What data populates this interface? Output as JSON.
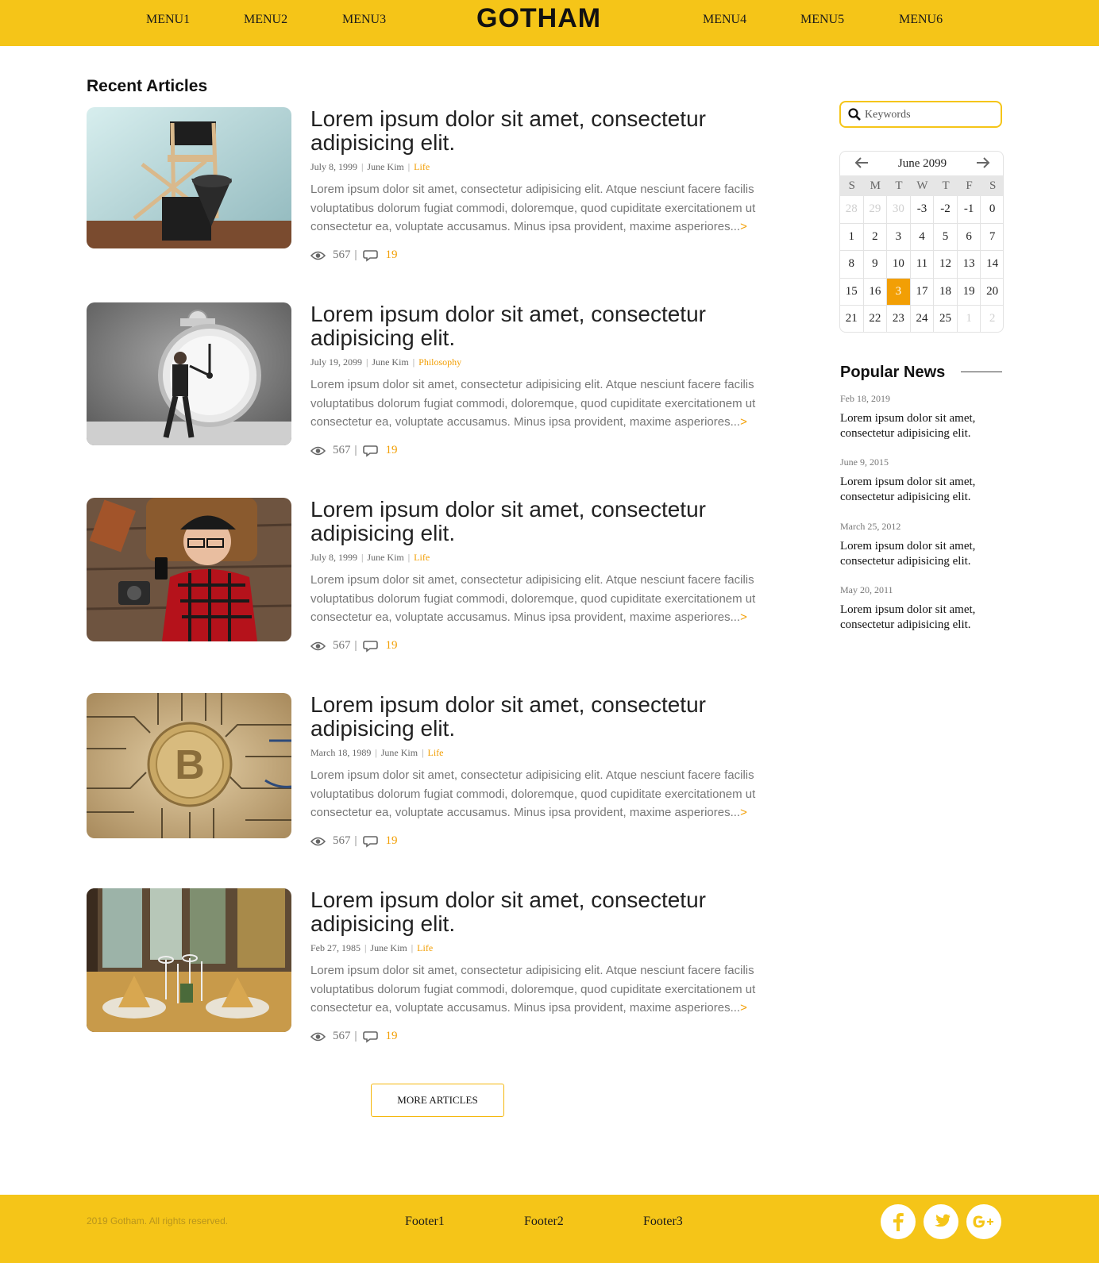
{
  "header": {
    "logo": "GOTHAM",
    "menus": [
      "MENU1",
      "MENU2",
      "MENU3",
      "MENU4",
      "MENU5",
      "MENU6"
    ]
  },
  "main": {
    "section_title": "Recent Articles",
    "articles": [
      {
        "title": "Lorem ipsum dolor sit amet, consectetur adipisicing elit.",
        "date": "July 8, 1999",
        "author": "June Kim",
        "category": "Life",
        "excerpt": "Lorem ipsum dolor sit amet, consectetur adipisicing elit. Atque nesciunt facere facilis voluptatibus dolorum fugiat commodi, doloremque, quod cupiditate exercitationem ut consectetur ea, voluptate accusamus. Minus ipsa provident, maxime asperiores...",
        "read_more": ">",
        "views": "567",
        "comments": "19",
        "image": "director-chair"
      },
      {
        "title": "Lorem ipsum dolor sit amet, consectetur adipisicing elit.",
        "date": "July 19, 2099",
        "author": "June Kim",
        "category": "Philosophy",
        "excerpt": "Lorem ipsum dolor sit amet, consectetur adipisicing elit. Atque nesciunt facere facilis voluptatibus dolorum fugiat commodi, doloremque, quod cupiditate exercitationem ut consectetur ea, voluptate accusamus. Minus ipsa provident, maxime asperiores...",
        "read_more": ">",
        "views": "567",
        "comments": "19",
        "image": "alarm-clock"
      },
      {
        "title": "Lorem ipsum dolor sit amet, consectetur adipisicing elit.",
        "date": "July 8, 1999",
        "author": "June Kim",
        "category": "Life",
        "excerpt": "Lorem ipsum dolor sit amet, consectetur adipisicing elit. Atque nesciunt facere facilis voluptatibus dolorum fugiat commodi, doloremque, quod cupiditate exercitationem ut consectetur ea, voluptate accusamus. Minus ipsa provident, maxime asperiores...",
        "read_more": ">",
        "views": "567",
        "comments": "19",
        "image": "woman-phone"
      },
      {
        "title": "Lorem ipsum dolor sit amet, consectetur adipisicing elit.",
        "date": "March 18, 1989",
        "author": "June Kim",
        "category": "Life",
        "excerpt": "Lorem ipsum dolor sit amet, consectetur adipisicing elit. Atque nesciunt facere facilis voluptatibus dolorum fugiat commodi, doloremque, quod cupiditate exercitationem ut consectetur ea, voluptate accusamus. Minus ipsa provident, maxime asperiores...",
        "read_more": ">",
        "views": "567",
        "comments": "19",
        "image": "bitcoin"
      },
      {
        "title": "Lorem ipsum dolor sit amet, consectetur adipisicing elit.",
        "date": "Feb 27, 1985",
        "author": "June Kim",
        "category": "Life",
        "excerpt": "Lorem ipsum dolor sit amet, consectetur adipisicing elit. Atque nesciunt facere facilis voluptatibus dolorum fugiat commodi, doloremque, quod cupiditate exercitationem ut consectetur ea, voluptate accusamus. Minus ipsa provident, maxime asperiores...",
        "read_more": ">",
        "views": "567",
        "comments": "19",
        "image": "restaurant-table"
      }
    ],
    "more_button": "MORE ARTICLES"
  },
  "sidebar": {
    "search": {
      "placeholder": "Keywords",
      "value": ""
    },
    "calendar": {
      "month": "June 2099",
      "weekdays": [
        "S",
        "M",
        "T",
        "W",
        "T",
        "F",
        "S"
      ],
      "days": [
        {
          "n": "28",
          "muted": true
        },
        {
          "n": "29",
          "muted": true
        },
        {
          "n": "30",
          "muted": true
        },
        {
          "n": "-3"
        },
        {
          "n": "-2"
        },
        {
          "n": "-1"
        },
        {
          "n": "0"
        },
        {
          "n": "1"
        },
        {
          "n": "2"
        },
        {
          "n": "3"
        },
        {
          "n": "4"
        },
        {
          "n": "5"
        },
        {
          "n": "6"
        },
        {
          "n": "7"
        },
        {
          "n": "8"
        },
        {
          "n": "9"
        },
        {
          "n": "10"
        },
        {
          "n": "11"
        },
        {
          "n": "12"
        },
        {
          "n": "13"
        },
        {
          "n": "14"
        },
        {
          "n": "15"
        },
        {
          "n": "16"
        },
        {
          "n": "3",
          "today": true
        },
        {
          "n": "17"
        },
        {
          "n": "18"
        },
        {
          "n": "19"
        },
        {
          "n": "20"
        },
        {
          "n": "21"
        },
        {
          "n": "22"
        },
        {
          "n": "23"
        },
        {
          "n": "24"
        },
        {
          "n": "25"
        },
        {
          "n": "1",
          "muted": true
        },
        {
          "n": "2",
          "muted": true
        }
      ]
    },
    "popular_title": "Popular News",
    "popular": [
      {
        "date": "Feb 18, 2019",
        "text": "Lorem ipsum dolor sit amet, consectetur adipisicing elit."
      },
      {
        "date": "June 9, 2015",
        "text": "Lorem ipsum dolor sit amet, consectetur adipisicing elit."
      },
      {
        "date": "March 25, 2012",
        "text": "Lorem ipsum dolor sit amet, consectetur adipisicing elit."
      },
      {
        "date": "May 20, 2011",
        "text": "Lorem ipsum dolor sit amet, consectetur adipisicing elit."
      }
    ]
  },
  "footer": {
    "copyright": "2019 Gotham. All rights reserved.",
    "links": [
      "Footer1",
      "Footer2",
      "Footer3"
    ],
    "social": [
      "facebook-icon",
      "twitter-icon",
      "google-plus-icon"
    ]
  },
  "colors": {
    "brand": "#f5c518",
    "accent": "#f29f05"
  }
}
